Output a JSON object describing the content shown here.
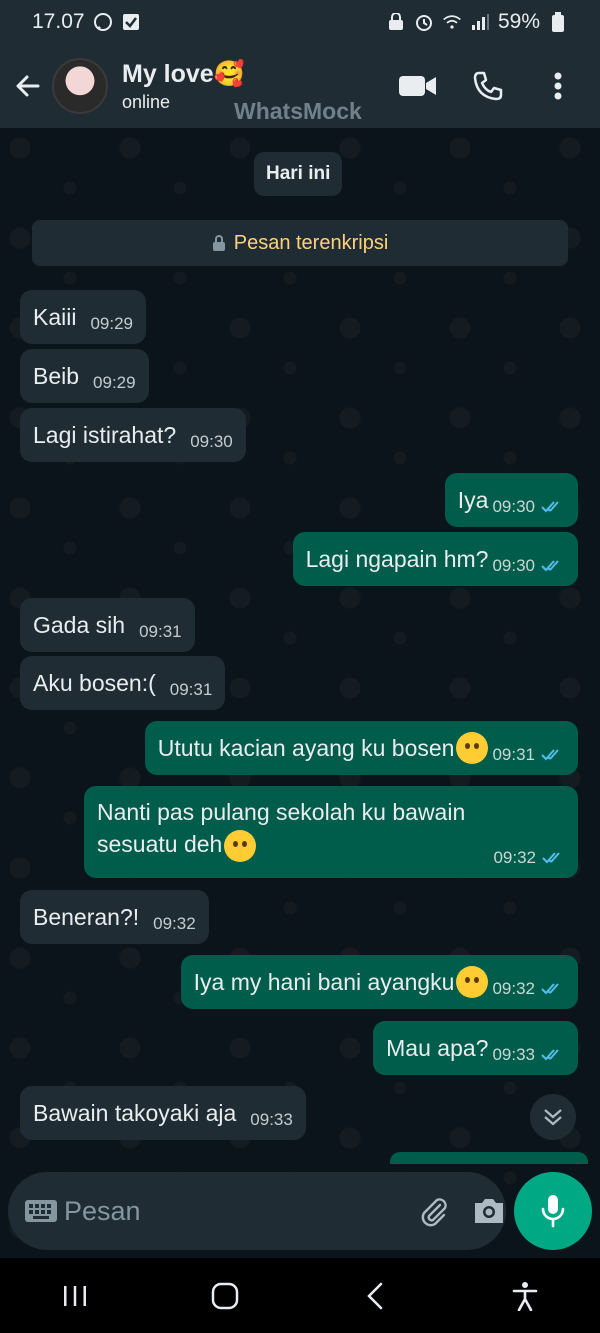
{
  "status_bar": {
    "time": "17.07",
    "battery": "59%"
  },
  "header": {
    "contact_name": "My love🥰",
    "contact_status": "online",
    "watermark": "WhatsMock"
  },
  "chat": {
    "date_chip": "Hari ini",
    "encryption_notice": "Pesan terenkripsi",
    "messages": [
      {
        "dir": "in",
        "text": "Kaiii",
        "time": "09:29"
      },
      {
        "dir": "in",
        "text": "Beib",
        "time": "09:29"
      },
      {
        "dir": "in",
        "text": "Lagi istirahat?",
        "time": "09:30"
      },
      {
        "dir": "out",
        "text": "Iya",
        "time": "09:30"
      },
      {
        "dir": "out",
        "text": "Lagi ngapain hm?",
        "time": "09:30"
      },
      {
        "dir": "in",
        "text": "Gada sih",
        "time": "09:31"
      },
      {
        "dir": "in",
        "text": "Aku bosen:(",
        "time": "09:31"
      },
      {
        "dir": "out",
        "text": "Ututu kacian ayang ku bosen",
        "time": "09:31"
      },
      {
        "dir": "out",
        "text": "Nanti pas pulang sekolah ku bawain sesuatu deh",
        "time": "09:32"
      },
      {
        "dir": "in",
        "text": "Beneran?!",
        "time": "09:32"
      },
      {
        "dir": "out",
        "text": "Iya my hani bani ayangku",
        "time": "09:32"
      },
      {
        "dir": "out",
        "text": "Mau apa?",
        "time": "09:33"
      },
      {
        "dir": "in",
        "text": "Bawain takoyaki aja",
        "time": "09:33"
      }
    ]
  },
  "input": {
    "placeholder": "Pesan"
  },
  "colors": {
    "incoming_bubble": "#1f2c34",
    "outgoing_bubble": "#005c4b",
    "accent": "#00a884",
    "read_ticks": "#53bdeb",
    "encryption_text": "#ffd279"
  },
  "icons": [
    "back-arrow-icon",
    "video-call-icon",
    "phone-icon",
    "more-options-icon",
    "lock-icon",
    "double-check-icon",
    "keyboard-icon",
    "attach-icon",
    "camera-icon",
    "mic-icon",
    "chevron-double-down-icon"
  ]
}
